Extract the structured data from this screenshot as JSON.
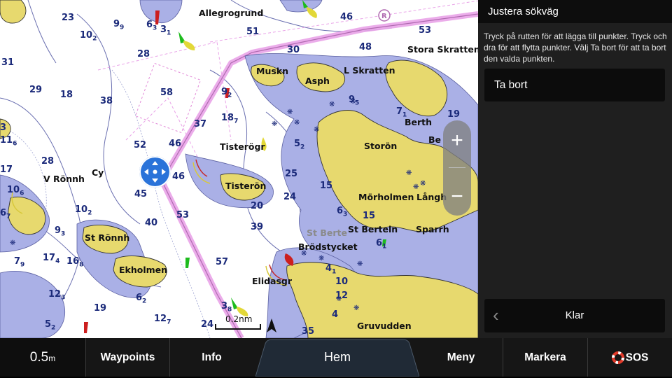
{
  "sidebar": {
    "title": "Justera sökväg",
    "instruction": "Tryck på rutten för att lägga till punkter. Tryck och dra för att flytta punkter. Välj Ta bort för att ta bort den valda punkten.",
    "remove_button": "Ta bort",
    "done_button": "Klar"
  },
  "zoom": {
    "plus": "+",
    "minus": "−"
  },
  "bottom_bar": {
    "zoom_level": "0.5",
    "zoom_unit": "m",
    "waypoints": "Waypoints",
    "info": "Info",
    "home": "Hem",
    "menu": "Meny",
    "mark": "Markera",
    "sos": "SOS"
  },
  "chart": {
    "scale_label": "0.2nm",
    "place_names": {
      "allegrogrund": "Allegrogrund",
      "stora_skratten": "Stora Skratten",
      "muskn": "Muskn",
      "asph": "Asph",
      "l_skratten": "L Skratten",
      "berth": "Berth",
      "storon": "Storön",
      "be": "Be",
      "tisterogr": "Tisterögr",
      "tisteron": "Tisterön",
      "morholmen": "Mörholmen",
      "langh": "Långh",
      "sparrh": "Sparrh",
      "st_berteln": "St Berteln",
      "st_berte": "St Berte",
      "brodstycket": "Brödstycket",
      "elidasgr": "Elidasgr",
      "gruvudden": "Gruvudden",
      "v_ronnh": "V Rönnh",
      "cy": "Cy",
      "st_ronnh": "St Rönnh",
      "ekholmen": "Ekholmen"
    },
    "depths": {
      "d23": "23",
      "d102": "10",
      "d102s": "2",
      "d99": "9",
      "d99s": "9",
      "d63": "6",
      "d63s": "3",
      "d31a": "3",
      "d31as": "1",
      "d51": "51",
      "d46": "46",
      "d53": "53",
      "d31": "31",
      "d28": "28",
      "d48": "48",
      "d30": "30",
      "d29": "29",
      "d18": "18",
      "d38": "38",
      "d58": "58",
      "d92": "9",
      "d92s": "2",
      "d95": "9",
      "d95s": "5",
      "d3": "3",
      "d116": "11",
      "d116s": "6",
      "d187": "18",
      "d187s": "7",
      "d37": "37",
      "d71": "7",
      "d71s": "1",
      "d19": "19",
      "d52": "52",
      "d46b": "46",
      "d52b": "5",
      "d52bs": "2",
      "d17": "17",
      "d28b": "28",
      "d46c": "46",
      "d45": "45",
      "d25": "25",
      "d15": "15",
      "d106": "10",
      "d106s": "6",
      "d24": "24",
      "d20": "20",
      "d102b": "10",
      "d102bs": "2",
      "d63b": "6",
      "d63bs": "3",
      "d67": "6",
      "d67s": "7",
      "d40": "40",
      "d93": "9",
      "d93s": "3",
      "d15b": "15",
      "d53b": "53",
      "d39": "39",
      "d61": "6",
      "d61s": "1",
      "d79": "7",
      "d79s": "9",
      "d174": "17",
      "d174s": "4",
      "d168": "16",
      "d168s": "8",
      "d41": "4",
      "d41s": "1",
      "d57": "57",
      "d123": "12",
      "d123s": "3",
      "d62": "6",
      "d62s": "2",
      "d10": "10",
      "d12": "12",
      "d19b": "19",
      "d127": "12",
      "d127s": "7",
      "d38b": "3",
      "d38bs": "8",
      "d24b": "24",
      "d35": "35",
      "d52c": "5",
      "d52cs": "2",
      "d4": "4"
    }
  },
  "colors": {
    "land": "#e7d96e",
    "shallow": "#aab0e6",
    "route": "#e9a3e8",
    "sidebar_bg": "#1f1f1f",
    "bottom_bg": "#161616",
    "depth_text": "#1b2a7a",
    "sos_red": "#e23a2a",
    "pan_blue": "#2a73d9"
  }
}
